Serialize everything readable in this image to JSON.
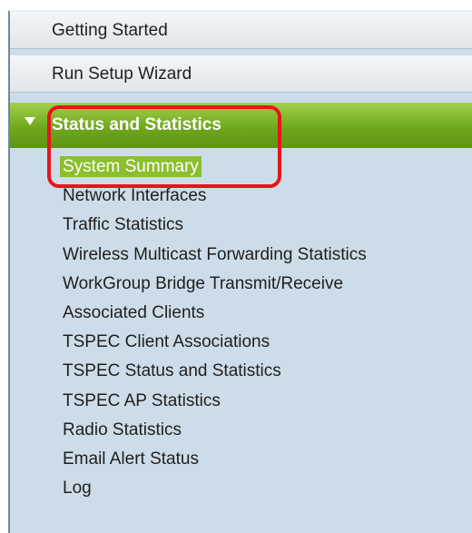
{
  "nav": {
    "top_items": [
      {
        "label": "Getting Started"
      },
      {
        "label": "Run Setup Wizard"
      }
    ],
    "section": {
      "label": "Status and Statistics",
      "arrow_icon": "triangle-down-icon",
      "items": [
        {
          "label": "System Summary",
          "active": true
        },
        {
          "label": "Network Interfaces"
        },
        {
          "label": "Traffic Statistics"
        },
        {
          "label": "Wireless Multicast Forwarding Statistics"
        },
        {
          "label": "WorkGroup Bridge Transmit/Receive"
        },
        {
          "label": "Associated Clients"
        },
        {
          "label": "TSPEC Client Associations"
        },
        {
          "label": "TSPEC Status and Statistics"
        },
        {
          "label": "TSPEC AP Statistics"
        },
        {
          "label": "Radio Statistics"
        },
        {
          "label": "Email Alert Status"
        },
        {
          "label": "Log"
        }
      ]
    }
  },
  "colors": {
    "panel_bg": "#ccdde9",
    "section_green": "#6fa81c",
    "active_item_bg": "#8bbf2e",
    "annotation_red": "#e8141d"
  }
}
